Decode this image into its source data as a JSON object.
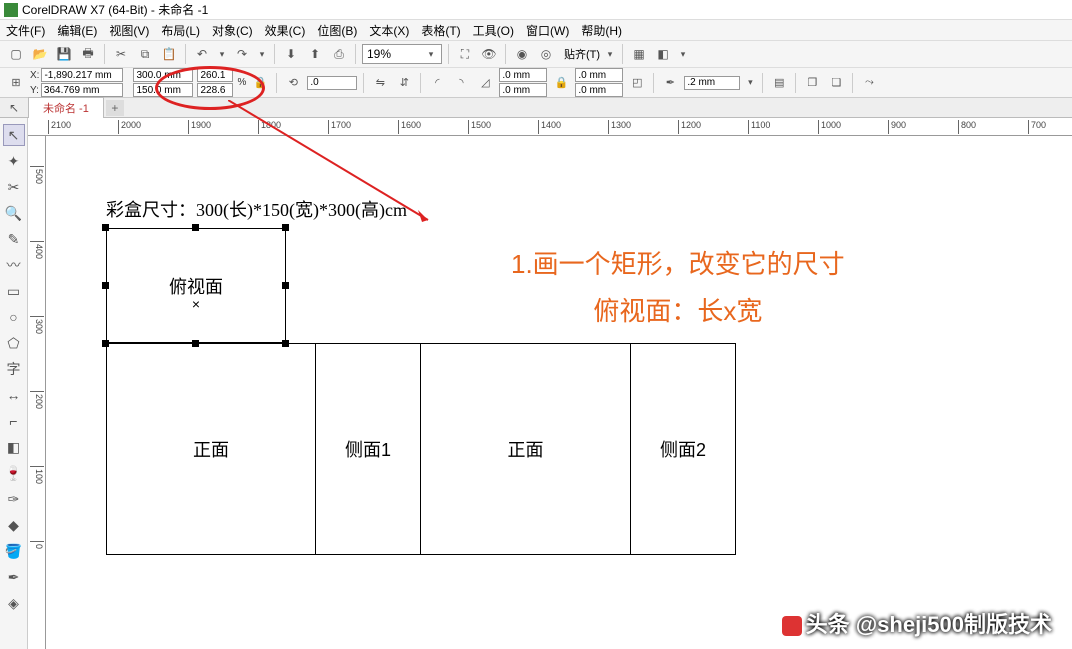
{
  "title": "CorelDRAW X7 (64-Bit) - 未命名 -1",
  "menu": [
    "文件(F)",
    "编辑(E)",
    "视图(V)",
    "布局(L)",
    "对象(C)",
    "效果(C)",
    "位图(B)",
    "文本(X)",
    "表格(T)",
    "工具(O)",
    "窗口(W)",
    "帮助(H)"
  ],
  "toolbar": {
    "zoom": "19%",
    "paste_label": "贴齐(T)"
  },
  "properties": {
    "x_label": "X:",
    "y_label": "Y:",
    "x": "-1,890.217 mm",
    "y": "364.769 mm",
    "width": "300.0 mm",
    "height": "150.0 mm",
    "scale_x": "260.1",
    "scale_y": "228.6",
    "pct": "%",
    "angle": ".0",
    "outline_a": ".0 mm",
    "outline_b": ".0 mm",
    "corner_a": ".0 mm",
    "corner_b": ".0 mm",
    "stroke": ".2 mm"
  },
  "doc_tab": "未命名 -1",
  "ruler_h": [
    "2100",
    "2000",
    "1900",
    "1800",
    "1700",
    "1600",
    "1500",
    "1400",
    "1300",
    "1200",
    "1100",
    "1000",
    "900",
    "800",
    "700"
  ],
  "ruler_v": [
    "500",
    "400",
    "300",
    "200",
    "100",
    "0"
  ],
  "drawing": {
    "title": "彩盒尺寸：300(长)*150(宽)*300(高)cm",
    "top_face": "俯视面",
    "front1": "正面",
    "side1": "侧面1",
    "front2": "正面",
    "side2": "侧面2"
  },
  "annotation": {
    "line1": "1.画一个矩形，改变它的尺寸",
    "line2": "俯视面：长x宽"
  },
  "watermark": "头条 @sheji500制版技术"
}
